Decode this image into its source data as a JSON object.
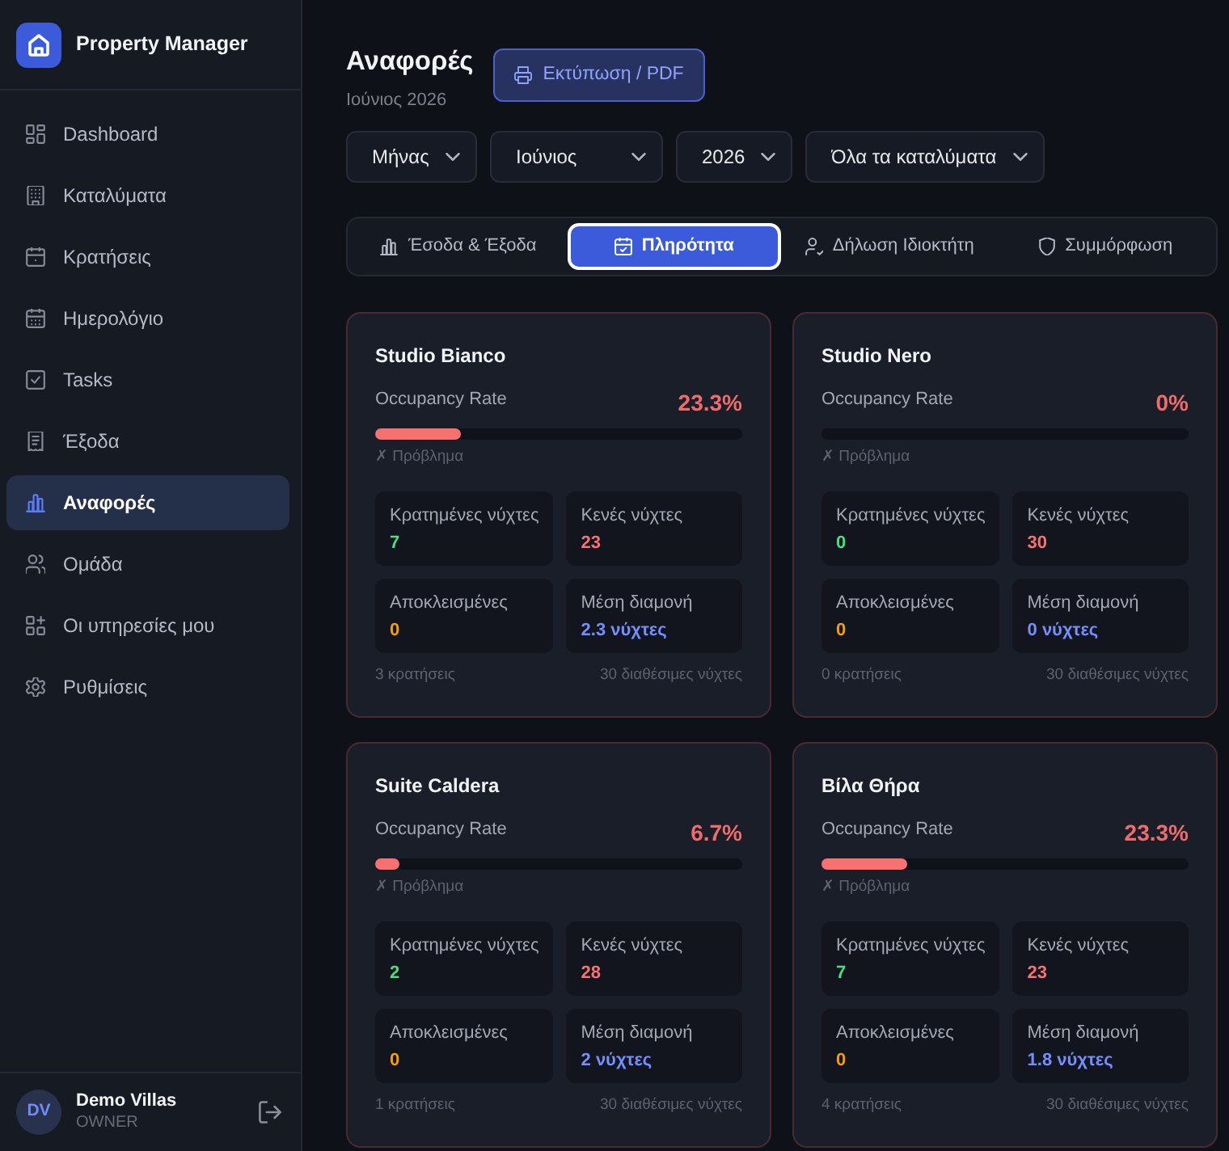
{
  "sidebar": {
    "brand": "Property Manager",
    "items": [
      {
        "label": "Dashboard",
        "selected": false
      },
      {
        "label": "Καταλύματα",
        "selected": false
      },
      {
        "label": "Κρατήσεις",
        "selected": false
      },
      {
        "label": "Ημερολόγιο",
        "selected": false
      },
      {
        "label": "Tasks",
        "selected": false
      },
      {
        "label": "Έξοδα",
        "selected": false
      },
      {
        "label": "Αναφορές",
        "selected": true
      },
      {
        "label": "Ομάδα",
        "selected": false
      },
      {
        "label": "Οι υπηρεσίες μου",
        "selected": false
      },
      {
        "label": "Ρυθμίσεις",
        "selected": false
      }
    ],
    "user": {
      "initials": "DV",
      "name": "Demo Villas",
      "role": "OWNER"
    }
  },
  "header": {
    "title": "Αναφορές",
    "subtitle": "Ιούνιος 2026",
    "print_button": "Εκτύπωση / PDF"
  },
  "filters": [
    {
      "value": "Μήνας"
    },
    {
      "value": "Ιούνιος"
    },
    {
      "value": "2026"
    },
    {
      "value": "Όλα τα καταλύματα"
    }
  ],
  "tabs": [
    {
      "label": "Έσοδα & Έξοδα",
      "selected": false
    },
    {
      "label": "Πληρότητα",
      "selected": true
    },
    {
      "label": "Δήλωση Ιδιοκτήτη",
      "selected": false
    },
    {
      "label": "Συμμόρφωση",
      "selected": false
    }
  ],
  "properties": [
    {
      "name": "Studio Bianco",
      "rate_label": "Occupancy Rate",
      "rate": "23.3%",
      "level": 0.233,
      "status": "✗ Πρόβλημα",
      "stats": [
        {
          "kind": "booked",
          "label": "Κρατημένες νύχτες",
          "value": "7"
        },
        {
          "kind": "vacant",
          "label": "Κενές νύχτες",
          "value": "23"
        },
        {
          "kind": "blocked",
          "label": "Αποκλεισμένες",
          "value": "0"
        },
        {
          "kind": "average",
          "label": "Μέση διαμονή",
          "value": "2.3 νύχτες"
        }
      ],
      "bookings": "3 κρατήσεις",
      "available": "30 διαθέσιμες νύχτες"
    },
    {
      "name": "Studio Nero",
      "rate_label": "Occupancy Rate",
      "rate": "0%",
      "status": "✗ Πρόβλημα",
      "stats": [
        {
          "kind": "booked",
          "label": "Κρατημένες νύχτες",
          "value": "0"
        },
        {
          "kind": "vacant",
          "label": "Κενές νύχτες",
          "value": "30"
        },
        {
          "kind": "blocked",
          "label": "Αποκλεισμένες",
          "value": "0"
        },
        {
          "kind": "average",
          "label": "Μέση διαμονή",
          "value": "0 νύχτες"
        }
      ],
      "bookings": "0 κρατήσεις",
      "available": "30 διαθέσιμες νύχτες"
    },
    {
      "name": "Suite Caldera",
      "rate_label": "Occupancy Rate",
      "rate": "6.7%",
      "level": 0.067,
      "status": "✗ Πρόβλημα",
      "stats": [
        {
          "kind": "booked",
          "label": "Κρατημένες νύχτες",
          "value": "2"
        },
        {
          "kind": "vacant",
          "label": "Κενές νύχτες",
          "value": "28"
        },
        {
          "kind": "blocked",
          "label": "Αποκλεισμένες",
          "value": "0"
        },
        {
          "kind": "average",
          "label": "Μέση διαμονή",
          "value": "2 νύχτες"
        }
      ],
      "bookings": "1 κρατήσεις",
      "available": "30 διαθέσιμες νύχτες"
    },
    {
      "name": "Βίλα Θήρα",
      "rate_label": "Occupancy Rate",
      "rate": "23.3%",
      "level": 0.233,
      "status": "✗ Πρόβλημα",
      "stats": [
        {
          "kind": "booked",
          "label": "Κρατημένες νύχτες",
          "value": "7"
        },
        {
          "kind": "vacant",
          "label": "Κενές νύχτες",
          "value": "23"
        },
        {
          "kind": "blocked",
          "label": "Αποκλεισμένες",
          "value": "0"
        },
        {
          "kind": "average",
          "label": "Μέση διαμονή",
          "value": "1.8 νύχτες"
        }
      ],
      "bookings": "4 κρατήσεις",
      "available": "30 διαθέσιμες νύχτες"
    }
  ]
}
